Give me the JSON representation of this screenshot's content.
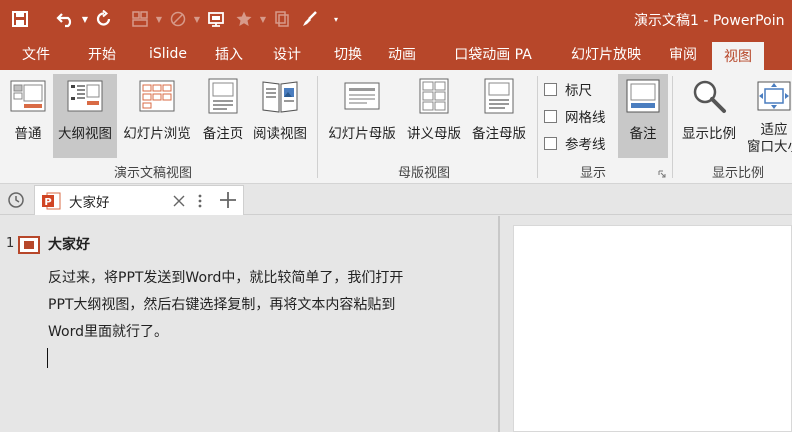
{
  "window": {
    "title": "演示文稿1 - PowerPoin"
  },
  "quick_access": [
    "save-icon",
    "undo-icon",
    "redo-icon",
    "layout-icon",
    "shape-icon",
    "presenter-icon",
    "star-icon",
    "copy-icon",
    "brush-icon",
    "customize-icon"
  ],
  "tabs": [
    {
      "label": "文件"
    },
    {
      "label": "开始"
    },
    {
      "label": "iSlide"
    },
    {
      "label": "插入"
    },
    {
      "label": "设计"
    },
    {
      "label": "切换"
    },
    {
      "label": "动画"
    },
    {
      "label": "口袋动画 PA"
    },
    {
      "label": "幻灯片放映"
    },
    {
      "label": "审阅"
    },
    {
      "label": "视图"
    }
  ],
  "ribbon": {
    "presentation_views": {
      "label": "演示文稿视图",
      "buttons": [
        "普通",
        "大纲视图",
        "幻灯片浏览",
        "备注页",
        "阅读视图"
      ],
      "selected": "大纲视图"
    },
    "master_views": {
      "label": "母版视图",
      "buttons": [
        "幻灯片母版",
        "讲义母版",
        "备注母版"
      ]
    },
    "show": {
      "label": "显示",
      "checkboxes": [
        {
          "label": "标尺",
          "checked": false
        },
        {
          "label": "网格线",
          "checked": false
        },
        {
          "label": "参考线",
          "checked": false
        }
      ],
      "notes_button": "备注"
    },
    "zoom": {
      "label": "显示比例",
      "buttons": [
        "显示比例",
        "适应",
        "窗口大小"
      ]
    }
  },
  "document_tab": {
    "name": "大家好"
  },
  "outline": {
    "slide_number": "1",
    "slide_title": "大家好",
    "body_lines": [
      "反过来，将PPT发送到Word中，就比较简单了，我们打开",
      "PPT大纲视图，然后右键选择复制，再将文本内容粘贴到",
      "Word里面就行了。"
    ]
  },
  "colors": {
    "accent": "#b7472a",
    "ribbon_bg": "#f3f3f3",
    "pane_bg": "#e6e6e6"
  }
}
